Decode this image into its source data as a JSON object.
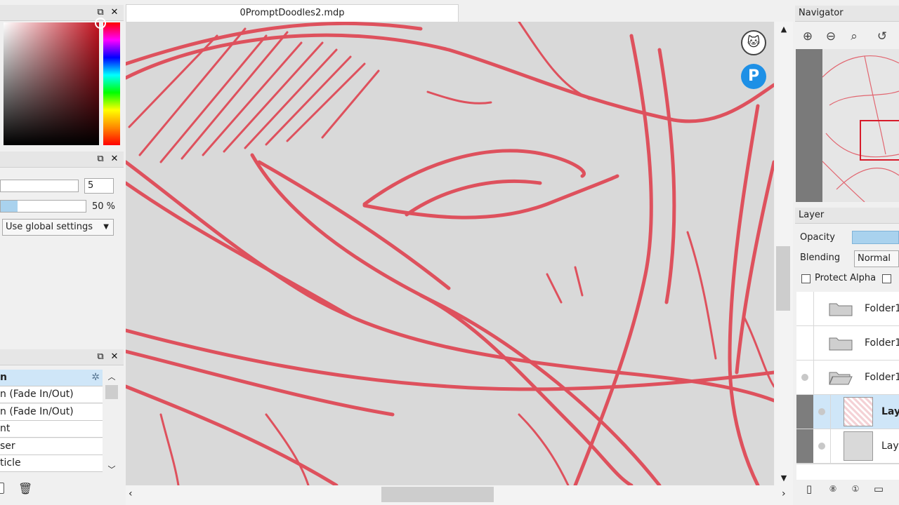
{
  "document": {
    "tab_title": "0PromptDoodles2.mdp"
  },
  "brush_settings": {
    "size_value": "5",
    "opacity_value": "50 %",
    "opacity_fraction": 0.2,
    "mode_select": "Use global settings"
  },
  "brush_list": {
    "items": [
      {
        "label": "n"
      },
      {
        "label": "n (Fade In/Out)"
      },
      {
        "label": "n (Fade In/Out)"
      },
      {
        "label": "nt"
      },
      {
        "label": "ser"
      },
      {
        "label": "ticle"
      }
    ]
  },
  "navigator": {
    "title": "Navigator"
  },
  "layer_panel": {
    "title": "Layer",
    "opacity_label": "Opacity",
    "blending_label": "Blending",
    "blending_value": "Normal",
    "protect_alpha_label": "Protect Alpha",
    "layers": [
      {
        "name": "Folder1"
      },
      {
        "name": "Folder1"
      },
      {
        "name": "Folder1"
      },
      {
        "name": "Lay"
      },
      {
        "name": "Lay"
      }
    ]
  },
  "colors": {
    "stroke": "#e0303f",
    "canvas": "#d9d9d9",
    "selection": "#cfe6f8",
    "pixiv_blue": "#1e90e6"
  }
}
